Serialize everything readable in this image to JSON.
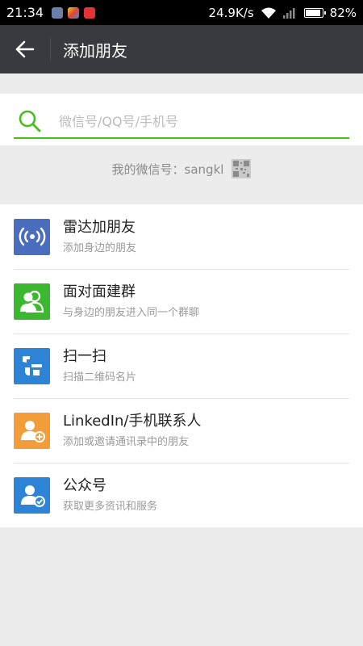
{
  "status_bar": {
    "time": "21:34",
    "speed": "24.9K/s",
    "battery": "82%",
    "battery_level": 0.82,
    "apps": [
      "app-icon-gallery",
      "app-icon-paint",
      "app-icon-red"
    ]
  },
  "header": {
    "title": "添加朋友"
  },
  "search": {
    "placeholder": "微信号/QQ号/手机号",
    "value": ""
  },
  "my_id": {
    "label": "我的微信号：sangkl"
  },
  "items": [
    {
      "title": "雷达加朋友",
      "subtitle": "添加身边的朋友",
      "icon": "radar-icon",
      "color": "#4b6dbe"
    },
    {
      "title": "面对面建群",
      "subtitle": "与身边的朋友进入同一个群聊",
      "icon": "group-icon",
      "color": "#3bb82f"
    },
    {
      "title": "扫一扫",
      "subtitle": "扫描二维码名片",
      "icon": "scan-icon",
      "color": "#2d83d5"
    },
    {
      "title": "LinkedIn/手机联系人",
      "subtitle": "添加或邀请通讯录中的朋友",
      "icon": "contact-add-icon",
      "color": "#f39c3a"
    },
    {
      "title": "公众号",
      "subtitle": "获取更多资讯和服务",
      "icon": "official-account-icon",
      "color": "#2d83d5"
    }
  ],
  "colors": {
    "accent": "#45c01a",
    "titlebar": "#393a3f",
    "background": "#ececec"
  }
}
